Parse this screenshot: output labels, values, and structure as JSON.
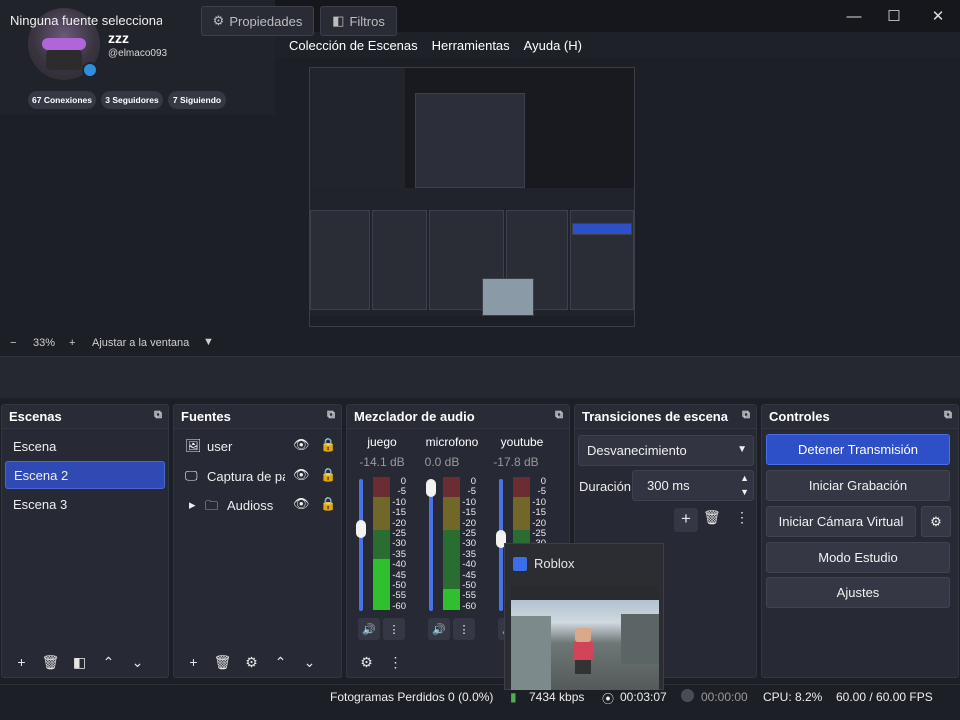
{
  "window": {
    "minimize_glyph": "—",
    "maximize_glyph": "☐",
    "close_glyph": "✕"
  },
  "menu": [
    "Colección de Escenas",
    "Herramientas",
    "Ayuda (H)"
  ],
  "profile": {
    "name": "zzz",
    "handle": "@elmaco093",
    "pills": [
      "67 Conexiones",
      "3 Seguidores",
      "7 Siguiendo"
    ]
  },
  "preview": {
    "zoom": "33%",
    "fit_label": "Ajustar a la ventana"
  },
  "source_toolbar": {
    "no_source": "Ninguna fuente seleccionada",
    "properties": "Propiedades",
    "filters": "Filtros"
  },
  "scenes": {
    "title": "Escenas",
    "items": [
      "Escena",
      "Escena 2",
      "Escena 3"
    ],
    "selected_index": 1
  },
  "sources": {
    "title": "Fuentes",
    "items": [
      "user",
      "Captura de pantalla",
      "Audioss"
    ]
  },
  "mixer": {
    "title": "Mezclador de audio",
    "channels": [
      {
        "name": "juego",
        "db": "-14.1 dB",
        "level": 0.38
      },
      {
        "name": "microfono",
        "db": "0.0 dB",
        "level": 0.16
      },
      {
        "name": "youtube",
        "db": "-17.8 dB",
        "level": 0.12
      }
    ],
    "ticks": [
      "0",
      "-5",
      "-10",
      "-15",
      "-20",
      "-25",
      "-30",
      "-35",
      "-40",
      "-45",
      "-50",
      "-55",
      "-60"
    ]
  },
  "transitions": {
    "title": "Transiciones de escena",
    "selected": "Desvanecimiento",
    "duration_label": "Duración",
    "duration_value": "300 ms"
  },
  "controls": {
    "title": "Controles",
    "buttons": [
      "Detener Transmisión",
      "Iniciar Grabación",
      "Iniciar Cámara Virtual",
      "Modo Estudio",
      "Ajustes"
    ]
  },
  "roblox_popup": {
    "title": "Roblox"
  },
  "status": {
    "dropped": "Fotogramas Perdidos 0 (0.0%)",
    "bitrate": "7434 kbps",
    "stream_time": "00:03:07",
    "rec_time": "00:00:00",
    "cpu": "CPU: 8.2%",
    "fps": "60.00 / 60.00 FPS"
  },
  "colors": {
    "accent": "#2d4fc7",
    "background": "#1d1f26",
    "panel": "#272a34",
    "meter_green": "#2fbf2f",
    "meter_yellow": "#c9b21c",
    "meter_red": "#c23030"
  }
}
